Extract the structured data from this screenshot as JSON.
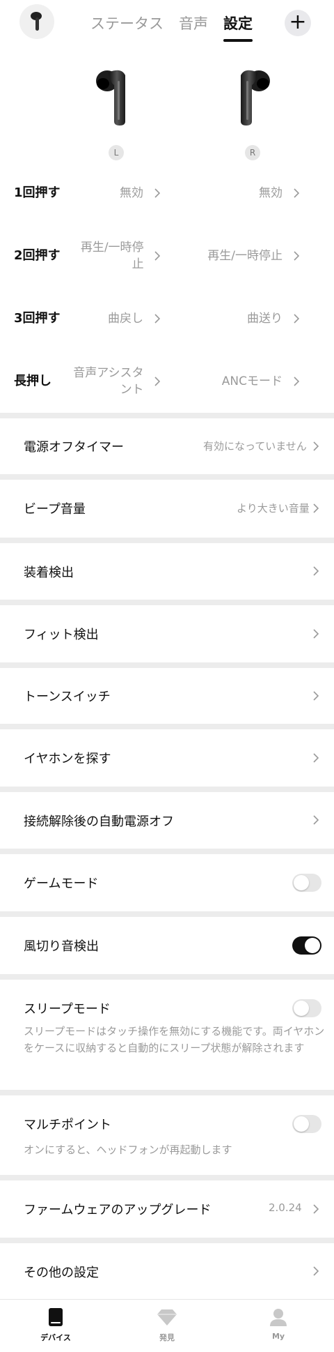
{
  "header": {
    "tabs": [
      {
        "label": "ステータス",
        "active": false
      },
      {
        "label": "音声",
        "active": false
      },
      {
        "label": "設定",
        "active": true
      }
    ],
    "add_label": "+"
  },
  "earbuds": {
    "left_label": "L",
    "right_label": "R"
  },
  "gestures": [
    {
      "title": "1回押す",
      "left": "無効",
      "right": "無効"
    },
    {
      "title": "2回押す",
      "left": "再生/一時停止",
      "right": "再生/一時停止"
    },
    {
      "title": "3回押す",
      "left": "曲戻し",
      "right": "曲送り"
    },
    {
      "title": "長押し",
      "left": "音声アシスタント",
      "right": "ANCモード"
    }
  ],
  "settings": {
    "power_off_timer": {
      "label": "電源オフタイマー",
      "value": "有効になっていません"
    },
    "beep_volume": {
      "label": "ビープ音量",
      "value": "より大きい音量"
    },
    "wear_detection": {
      "label": "装着検出"
    },
    "fit_test": {
      "label": "フィット検出"
    },
    "tone_switch": {
      "label": "トーンスイッチ"
    },
    "find_earphones": {
      "label": "イヤホンを探す"
    },
    "auto_power_off": {
      "label": "接続解除後の自動電源オフ"
    },
    "game_mode": {
      "label": "ゲームモード",
      "on": false
    },
    "wind_noise": {
      "label": "風切り音検出",
      "on": true
    },
    "sleep_mode": {
      "label": "スリープモード",
      "on": false,
      "desc": "スリープモードはタッチ操作を無効にする機能です。両イヤホンをケースに収納すると自動的にスリープ状態が解除されます"
    },
    "multipoint": {
      "label": "マルチポイント",
      "on": false,
      "desc": "オンにすると、ヘッドフォンが再起動します"
    },
    "firmware": {
      "label": "ファームウェアのアップグレード",
      "value": "2.0.24"
    },
    "other": {
      "label": "その他の設定"
    }
  },
  "nav": [
    {
      "label": "デバイス",
      "active": true,
      "icon": "device-icon"
    },
    {
      "label": "発見",
      "active": false,
      "icon": "discover-icon"
    },
    {
      "label": "My",
      "active": false,
      "icon": "profile-icon"
    }
  ],
  "colors": {
    "accent": "#111111",
    "muted": "#9a9a9a",
    "background": "#ececec",
    "card": "#ffffff"
  }
}
